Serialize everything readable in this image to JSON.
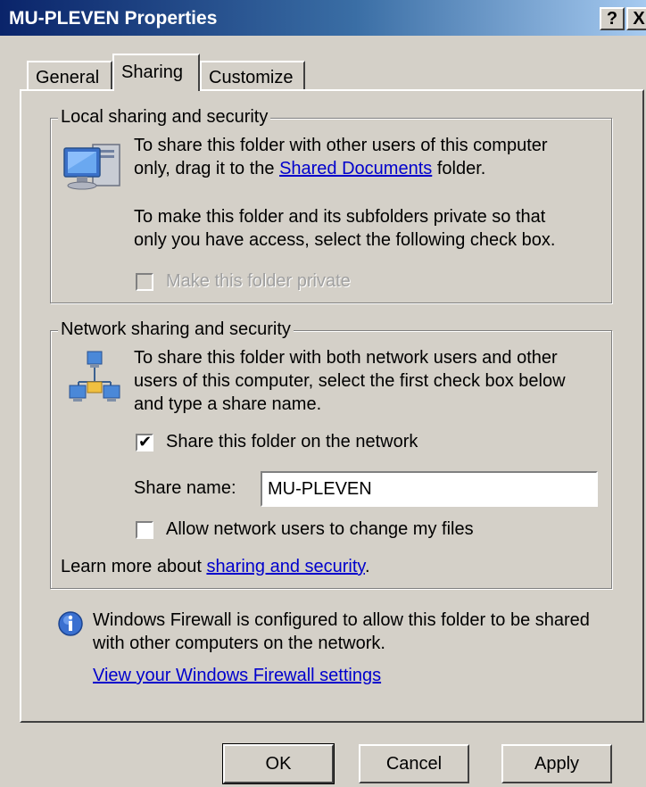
{
  "window": {
    "title": "MU-PLEVEN Properties",
    "help_label": "?",
    "close_label": "X"
  },
  "tabs": [
    {
      "label": "General",
      "selected": false
    },
    {
      "label": "Sharing",
      "selected": true
    },
    {
      "label": "Customize",
      "selected": false
    }
  ],
  "local_sharing": {
    "legend": "Local sharing and security",
    "text1_a": "To share this folder with other users of this computer",
    "text1_b": "only, drag it to the ",
    "link": "Shared Documents",
    "text1_c": " folder.",
    "text2_a": "To make this folder and its subfolders private so that",
    "text2_b": "only you have access, select the following check box.",
    "private_label": "Make this folder private",
    "private_checked": false,
    "private_enabled": false
  },
  "network_sharing": {
    "legend": "Network sharing and security",
    "text_a": "To share this folder with both network users and other",
    "text_b": "users of this computer, select the first check box below",
    "text_c": "and type a share name.",
    "share_label": "Share this folder on the network",
    "share_checked": true,
    "share_name_label": "Share name:",
    "share_name_value": "MU-PLEVEN",
    "allow_label": "Allow network users to change my files",
    "allow_checked": false,
    "learn_prefix": "Learn more about ",
    "learn_link": "sharing and security",
    "learn_suffix": "."
  },
  "firewall": {
    "text_a": "Windows Firewall is configured to allow this folder to be shared",
    "text_b": "with other computers on the network.",
    "link": "View your Windows Firewall settings"
  },
  "buttons": {
    "ok": "OK",
    "cancel": "Cancel",
    "apply": "Apply"
  },
  "colors": {
    "title_gradient_start": "#0a246a",
    "title_gradient_end": "#a6caf0",
    "dialog_background": "#d4d0c8",
    "link": "#0000cc"
  }
}
